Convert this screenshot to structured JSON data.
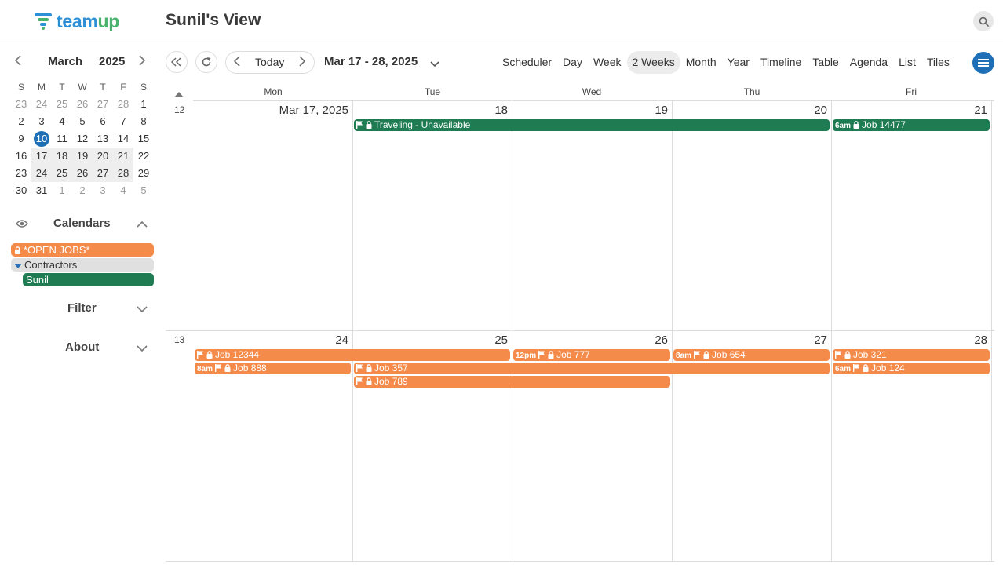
{
  "header": {
    "logo_text_a": "team",
    "logo_text_b": "up",
    "view_title": "Sunil's View"
  },
  "mini_calendar": {
    "month": "March",
    "year": "2025",
    "dow": [
      "S",
      "M",
      "T",
      "W",
      "T",
      "F",
      "S"
    ],
    "weeks": [
      [
        "23",
        "24",
        "25",
        "26",
        "27",
        "28",
        "1"
      ],
      [
        "2",
        "3",
        "4",
        "5",
        "6",
        "7",
        "8"
      ],
      [
        "9",
        "10",
        "11",
        "12",
        "13",
        "14",
        "15"
      ],
      [
        "16",
        "17",
        "18",
        "19",
        "20",
        "21",
        "22"
      ],
      [
        "23",
        "24",
        "25",
        "26",
        "27",
        "28",
        "29"
      ],
      [
        "30",
        "31",
        "1",
        "2",
        "3",
        "4",
        "5"
      ]
    ],
    "today": "10"
  },
  "calendars": {
    "title": "Calendars",
    "open_jobs": "*OPEN JOBS*",
    "contractors": "Contractors",
    "sunil": "Sunil"
  },
  "sidebar": {
    "filter": "Filter",
    "about": "About"
  },
  "toolbar": {
    "today": "Today",
    "range": "Mar 17 - 28, 2025",
    "views": [
      "Scheduler",
      "Day",
      "Week",
      "2 Weeks",
      "Month",
      "Year",
      "Timeline",
      "Table",
      "Agenda",
      "List",
      "Tiles"
    ],
    "active_view": "2 Weeks"
  },
  "grid": {
    "dow": [
      "Mon",
      "Tue",
      "Wed",
      "Thu",
      "Fri"
    ],
    "weeks": [
      {
        "week_num": "12",
        "days": [
          "Mar 17, 2025",
          "18",
          "19",
          "20",
          "21"
        ]
      },
      {
        "week_num": "13",
        "days": [
          "24",
          "25",
          "26",
          "27",
          "28"
        ]
      }
    ]
  },
  "events": [
    {
      "label": "Traveling - Unavailable",
      "time": "",
      "calendar": "Sunil",
      "flag": true
    },
    {
      "label": "Job 14477",
      "time": "6am",
      "calendar": "Sunil",
      "flag": false
    },
    {
      "label": "Job 12344",
      "time": "",
      "calendar": "*OPEN JOBS*",
      "flag": true
    },
    {
      "label": "Job 777",
      "time": "12pm",
      "calendar": "*OPEN JOBS*",
      "flag": true
    },
    {
      "label": "Job 654",
      "time": "8am",
      "calendar": "*OPEN JOBS*",
      "flag": true
    },
    {
      "label": "Job 321",
      "time": "",
      "calendar": "*OPEN JOBS*",
      "flag": true
    },
    {
      "label": "Job 888",
      "time": "8am",
      "calendar": "*OPEN JOBS*",
      "flag": true
    },
    {
      "label": "Job 357",
      "time": "",
      "calendar": "*OPEN JOBS*",
      "flag": true
    },
    {
      "label": "Job 124",
      "time": "6am",
      "calendar": "*OPEN JOBS*",
      "flag": true
    },
    {
      "label": "Job 789",
      "time": "",
      "calendar": "*OPEN JOBS*",
      "flag": true
    }
  ],
  "colors": {
    "open_jobs": "#f48b4a",
    "sunil": "#1e7b52",
    "accent": "#1f6fb6"
  }
}
